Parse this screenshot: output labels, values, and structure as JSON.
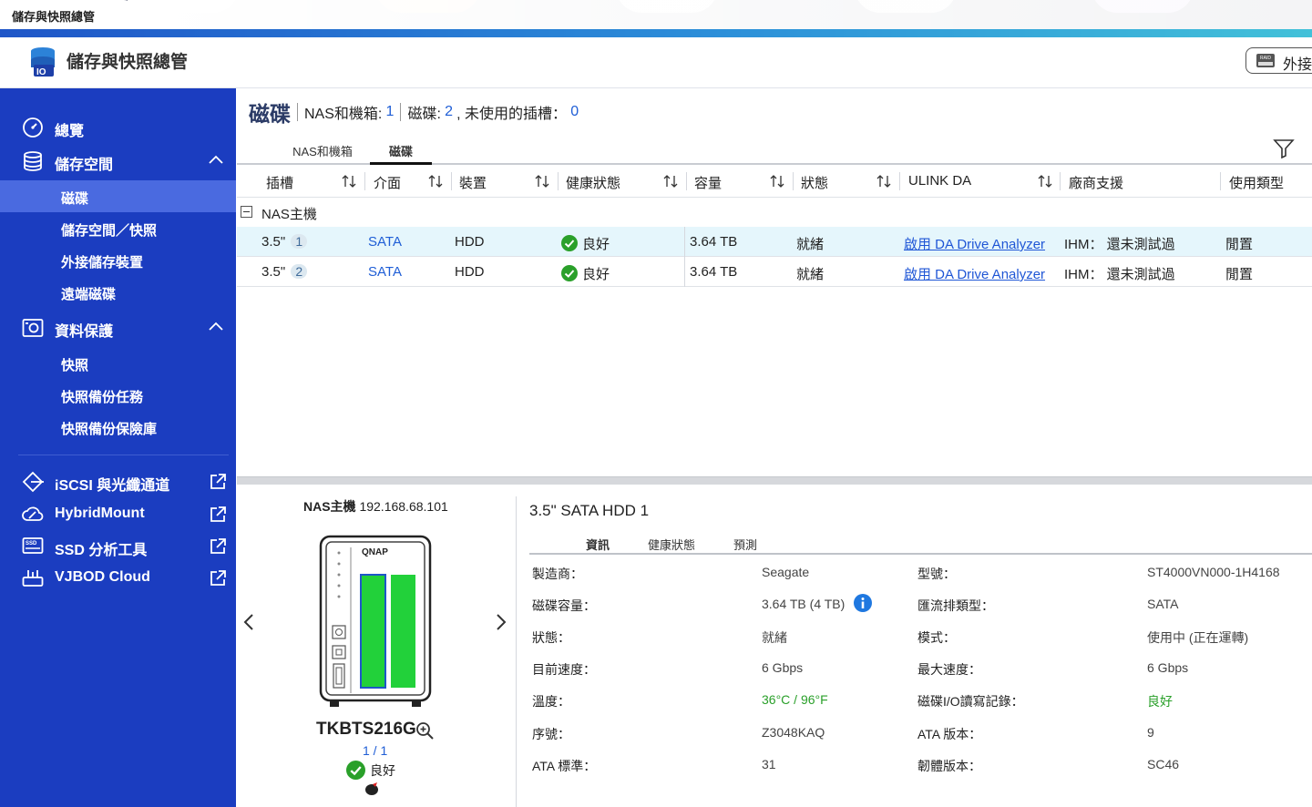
{
  "window": {
    "tab_title": "儲存與快照總管"
  },
  "header": {
    "app_title": "儲存與快照總管",
    "external_button_label": "外接"
  },
  "sidebar": {
    "overview": "總覽",
    "storage": "儲存空間",
    "storage_items": [
      "磁碟",
      "儲存空間／快照",
      "外接儲存裝置",
      "遠端磁碟"
    ],
    "protection": "資料保護",
    "protection_items": [
      "快照",
      "快照備份任務",
      "快照備份保險庫"
    ],
    "tools": [
      "iSCSI 與光纖通道",
      "HybridMount",
      "SSD 分析工具",
      "VJBOD Cloud"
    ]
  },
  "page": {
    "title": "磁碟",
    "nas_label": "NAS和機箱:",
    "nas_count": "1",
    "disk_label": "磁碟:",
    "disk_count": "2",
    "unused_label": ", 未使用的插槽：",
    "unused_count": "0"
  },
  "tabs": [
    "NAS和機箱",
    "磁碟"
  ],
  "table": {
    "columns": [
      "插槽",
      "介面",
      "裝置",
      "健康狀態",
      "容量",
      "狀態",
      "ULINK DA",
      "廠商支援",
      "使用類型"
    ],
    "group": "NAS主機",
    "rows": [
      {
        "slot": "3.5\"",
        "slot_no": "1",
        "interface": "SATA",
        "device": "HDD",
        "health": "良好",
        "capacity": "3.64 TB",
        "status": "就緒",
        "ulink": "啟用 DA Drive Analyzer",
        "vendor": "IHM： 還未測試過",
        "usage": "閒置"
      },
      {
        "slot": "3.5\"",
        "slot_no": "2",
        "interface": "SATA",
        "device": "HDD",
        "health": "良好",
        "capacity": "3.64 TB",
        "status": "就緒",
        "ulink": "啟用 DA Drive Analyzer",
        "vendor": "IHM： 還未測試過",
        "usage": "閒置"
      }
    ]
  },
  "nas_panel": {
    "name": "NAS主機",
    "ip": "192.168.68.101",
    "brand": "QNAP",
    "model": "TKBTS216G",
    "pager": "1 / 1",
    "status": "良好"
  },
  "detail": {
    "title": "3.5\" SATA HDD 1",
    "tabs": [
      "資訊",
      "健康狀態",
      "預測"
    ],
    "left": [
      {
        "label": "製造商：",
        "value": "Seagate"
      },
      {
        "label": "磁碟容量：",
        "value": "3.64 TB (4 TB)"
      },
      {
        "label": "狀態：",
        "value": "就緒"
      },
      {
        "label": "目前速度：",
        "value": "6 Gbps"
      },
      {
        "label": "溫度：",
        "value": "36°C / 96°F"
      },
      {
        "label": "序號：",
        "value": "Z3048KAQ"
      },
      {
        "label": "ATA 標準：",
        "value": "31"
      }
    ],
    "right": [
      {
        "label": "型號：",
        "value": "ST4000VN000-1H4168"
      },
      {
        "label": "匯流排類型：",
        "value": "SATA"
      },
      {
        "label": "模式：",
        "value": "使用中 (正在運轉)"
      },
      {
        "label": "最大速度：",
        "value": "6 Gbps"
      },
      {
        "label": "磁碟I/O讀寫記錄：",
        "value": "良好"
      },
      {
        "label": "ATA 版本：",
        "value": "9"
      },
      {
        "label": "韌體版本：",
        "value": "SC46"
      }
    ]
  },
  "colors": {
    "sidebar": "#1b3dc0",
    "sidebar_active": "#4a6ae0",
    "accent": "#1f5ed6",
    "ok_green": "#2aa02a",
    "drive_bay": "#22d13a"
  },
  "icons": [
    "gauge-icon",
    "database-icon",
    "camera-icon",
    "iscsi-icon",
    "hybridmount-icon",
    "ssd-icon",
    "vjbod-icon",
    "external-link-icon",
    "filter-icon",
    "sort-icon",
    "check-circle-icon",
    "info-icon",
    "zoom-icon"
  ]
}
